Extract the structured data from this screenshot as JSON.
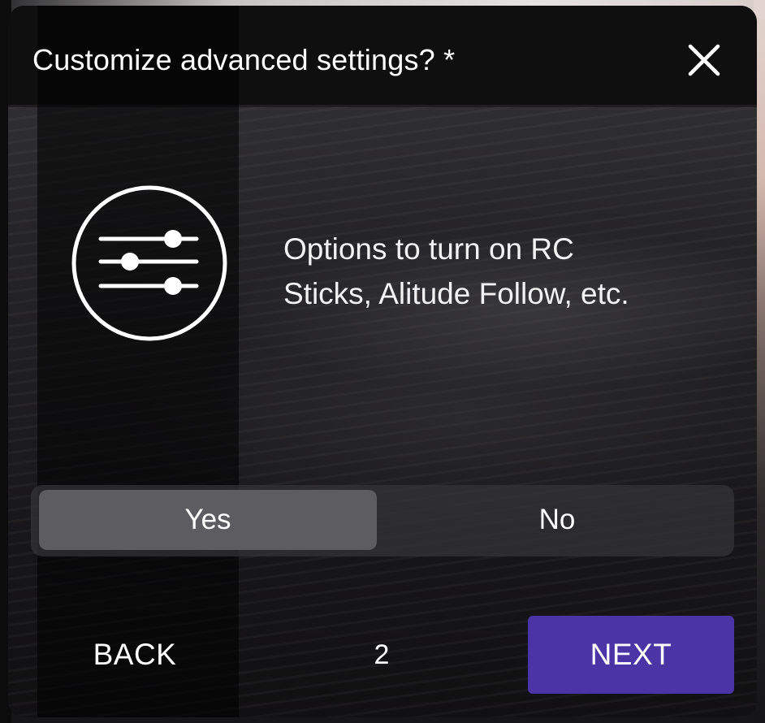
{
  "dialog": {
    "title": "Customize advanced settings? *",
    "close_icon": "close-icon",
    "illustration_icon": "sliders-settings-icon",
    "description": "Options to turn on RC\nSticks, Alitude Follow, etc."
  },
  "choice": {
    "options": [
      "Yes",
      "No"
    ],
    "selected": "Yes"
  },
  "footer": {
    "back_label": "BACK",
    "page_number": "2",
    "next_label": "NEXT"
  },
  "colors": {
    "accent": "#4a34a6",
    "selected_option": "#5d5d61",
    "header": "#0f0f10"
  }
}
